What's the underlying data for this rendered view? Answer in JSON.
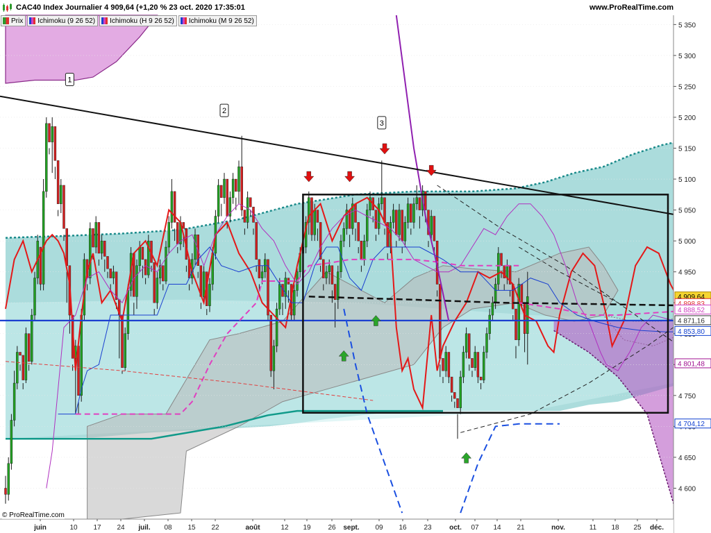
{
  "header": {
    "title": "CAC40 Index Journalier 4 909,64 (+1,20 % 23 oct. 2020 17:35:01",
    "site": "www.ProRealTime.com"
  },
  "legend": [
    {
      "label": "Prix",
      "color": "#2e9a2e"
    },
    {
      "label": "Ichimoku (9 26 52)",
      "color": "#9b3fc9"
    },
    {
      "label": "Ichimoku (H 9 26 52)",
      "color": "#9b3fc9"
    },
    {
      "label": "Ichimoku (M 9 26 52)",
      "color": "#9b3fc9"
    }
  ],
  "copyright": "© ProRealTime.com",
  "chart_data": {
    "type": "candlestick",
    "y_range": [
      4550,
      5365
    ],
    "y_ticks": [
      {
        "v": 5350,
        "label": "5 350"
      },
      {
        "v": 5300,
        "label": "5 300"
      },
      {
        "v": 5250,
        "label": "5 250"
      },
      {
        "v": 5200,
        "label": "5 200"
      },
      {
        "v": 5150,
        "label": "5 150"
      },
      {
        "v": 5100,
        "label": "5 100"
      },
      {
        "v": 5050,
        "label": "5 050"
      },
      {
        "v": 5000,
        "label": "5 000"
      },
      {
        "v": 4950,
        "label": "4 950"
      },
      {
        "v": 4900,
        "label": "4 900"
      },
      {
        "v": 4850,
        "label": "4 850"
      },
      {
        "v": 4800,
        "label": "4 800"
      },
      {
        "v": 4750,
        "label": "4 750"
      },
      {
        "v": 4700,
        "label": "4 700"
      },
      {
        "v": 4650,
        "label": "4 650"
      },
      {
        "v": 4600,
        "label": "4 600"
      }
    ],
    "x_ticks": [
      {
        "label": "juin",
        "bold": true
      },
      {
        "label": "10"
      },
      {
        "label": "17"
      },
      {
        "label": "24"
      },
      {
        "label": "juil.",
        "bold": true
      },
      {
        "label": "08"
      },
      {
        "label": "15"
      },
      {
        "label": "22"
      },
      {
        "label": "août",
        "bold": true
      },
      {
        "label": "12"
      },
      {
        "label": "19"
      },
      {
        "label": "26"
      },
      {
        "label": "sept.",
        "bold": true
      },
      {
        "label": "09"
      },
      {
        "label": "16"
      },
      {
        "label": "23"
      },
      {
        "label": "oct.",
        "bold": true
      },
      {
        "label": "07"
      },
      {
        "label": "14"
      },
      {
        "label": "21"
      },
      {
        "label": "nov.",
        "bold": true
      },
      {
        "label": "11"
      },
      {
        "label": "18"
      },
      {
        "label": "25"
      },
      {
        "label": "déc.",
        "bold": true
      }
    ],
    "price_badges": [
      {
        "v": 4909.64,
        "label": "4 909,64",
        "bg": "#f5d530",
        "fg": "#000000"
      },
      {
        "v": 4898.83,
        "label": "4 898,83",
        "bg": "#ffffff",
        "fg": "#e03030"
      },
      {
        "v": 4888.52,
        "label": "4 888,52",
        "bg": "#ffffff",
        "fg": "#d040c0"
      },
      {
        "v": 4871.16,
        "label": "4 871,16",
        "bg": "#ffffff",
        "fg": "#303030"
      },
      {
        "v": 4853.8,
        "label": "4 853,80",
        "bg": "#ffffff",
        "fg": "#1040d0"
      },
      {
        "v": 4801.48,
        "label": "4 801,48",
        "bg": "#ffffff",
        "fg": "#a01090"
      },
      {
        "v": 4704.12,
        "label": "4 704,12",
        "bg": "#ffffff",
        "fg": "#1040d0"
      }
    ],
    "annotations": [
      {
        "label": "1",
        "index": 22,
        "v": 5260
      },
      {
        "label": "2",
        "index": 75,
        "v": 5210
      },
      {
        "label": "3",
        "index": 129,
        "v": 5190
      }
    ],
    "candles": [
      [
        4600,
        4620,
        4575,
        4590
      ],
      [
        4590,
        4650,
        4580,
        4640
      ],
      [
        4640,
        4720,
        4630,
        4710
      ],
      [
        4710,
        4790,
        4700,
        4770
      ],
      [
        4770,
        4830,
        4760,
        4820
      ],
      [
        4820,
        4800,
        4790,
        4815
      ],
      [
        4815,
        4770,
        4760,
        4775
      ],
      [
        4775,
        4860,
        4770,
        4850
      ],
      [
        4850,
        4800,
        4790,
        4805
      ],
      [
        4805,
        4890,
        4800,
        4880
      ],
      [
        4880,
        4950,
        4870,
        4940
      ],
      [
        4940,
        5010,
        4930,
        5000
      ],
      [
        4990,
        4930,
        4920,
        4930
      ],
      [
        4930,
        5100,
        4920,
        5080
      ],
      [
        5080,
        5200,
        5070,
        5190
      ],
      [
        5190,
        5150,
        5140,
        5160
      ],
      [
        5160,
        5200,
        5110,
        5185
      ],
      [
        5185,
        5120,
        5100,
        5130
      ],
      [
        5130,
        5050,
        5040,
        5060
      ],
      [
        5060,
        5100,
        5045,
        5090
      ],
      [
        5090,
        5010,
        5000,
        5020
      ],
      [
        5020,
        4950,
        4900,
        4960
      ],
      [
        4960,
        4890,
        4850,
        4880
      ],
      [
        4880,
        4800,
        4790,
        4810
      ],
      [
        4810,
        4840,
        4720,
        4830
      ],
      [
        4830,
        4740,
        4720,
        4750
      ],
      [
        4750,
        4890,
        4740,
        4880
      ],
      [
        4880,
        4980,
        4870,
        4970
      ],
      [
        4970,
        4930,
        4920,
        4940
      ],
      [
        4940,
        5030,
        4930,
        5020
      ],
      [
        5020,
        4980,
        4970,
        4990
      ],
      [
        4990,
        5040,
        4980,
        5030
      ],
      [
        5030,
        4970,
        4960,
        4980
      ],
      [
        4980,
        5010,
        4970,
        5000
      ],
      [
        5000,
        4970,
        4950,
        4975
      ],
      [
        4975,
        4950,
        4940,
        4955
      ],
      [
        4955,
        4930,
        4920,
        4940
      ],
      [
        4940,
        4960,
        4930,
        4950
      ],
      [
        4950,
        4900,
        4890,
        4905
      ],
      [
        4905,
        4880,
        4810,
        4880
      ],
      [
        4880,
        4790,
        4785,
        4795
      ],
      [
        4795,
        4860,
        4790,
        4850
      ],
      [
        4850,
        4930,
        4840,
        4920
      ],
      [
        4920,
        4990,
        4910,
        4980
      ],
      [
        4980,
        4900,
        4880,
        4910
      ],
      [
        4910,
        4970,
        4890,
        4960
      ],
      [
        4960,
        5000,
        4950,
        4990
      ],
      [
        4990,
        4960,
        4940,
        4970
      ],
      [
        4970,
        4940,
        4930,
        4945
      ],
      [
        4945,
        5010,
        4940,
        5000
      ],
      [
        5000,
        4960,
        4950,
        4965
      ],
      [
        4965,
        4890,
        4880,
        4900
      ],
      [
        4900,
        4950,
        4890,
        4940
      ],
      [
        4940,
        4970,
        4930,
        4960
      ],
      [
        4960,
        4930,
        4920,
        4935
      ],
      [
        4935,
        5000,
        4930,
        4990
      ],
      [
        4990,
        5040,
        4980,
        5030
      ],
      [
        5030,
        5100,
        5020,
        5080
      ],
      [
        5080,
        5020,
        5000,
        5030
      ],
      [
        5030,
        4990,
        4980,
        4995
      ],
      [
        4995,
        5040,
        4985,
        5030
      ],
      [
        5030,
        5010,
        4990,
        5020
      ],
      [
        5020,
        4960,
        4950,
        4970
      ],
      [
        4970,
        4930,
        4920,
        4940
      ],
      [
        4940,
        4980,
        4930,
        4970
      ],
      [
        4970,
        5020,
        4960,
        5010
      ],
      [
        5010,
        4950,
        4940,
        4960
      ],
      [
        4960,
        4900,
        4890,
        4910
      ],
      [
        4910,
        4960,
        4900,
        4950
      ],
      [
        4950,
        4890,
        4880,
        4895
      ],
      [
        4895,
        4940,
        4885,
        4930
      ],
      [
        4930,
        4990,
        4920,
        4980
      ],
      [
        4980,
        5050,
        4970,
        5040
      ],
      [
        5040,
        5100,
        5030,
        5090
      ],
      [
        5090,
        5060,
        5040,
        5070
      ],
      [
        5070,
        5110,
        5060,
        5100
      ],
      [
        5100,
        5030,
        5020,
        5040
      ],
      [
        5040,
        5080,
        5030,
        5070
      ],
      [
        5070,
        5110,
        5060,
        5100
      ],
      [
        5100,
        5070,
        5050,
        5080
      ],
      [
        5080,
        5130,
        5060,
        5120
      ],
      [
        5120,
        5170,
        5040,
        5050
      ],
      [
        5050,
        5020,
        5010,
        5030
      ],
      [
        5030,
        5080,
        5020,
        5070
      ],
      [
        5070,
        5050,
        5040,
        5055
      ],
      [
        5055,
        5020,
        5010,
        5030
      ],
      [
        5030,
        4960,
        4950,
        4970
      ],
      [
        4970,
        4930,
        4920,
        4940
      ],
      [
        4940,
        4960,
        4930,
        4950
      ],
      [
        4950,
        4980,
        4940,
        4970
      ],
      [
        4970,
        4900,
        4870,
        4880
      ],
      [
        4880,
        4800,
        4780,
        4790
      ],
      [
        4790,
        4840,
        4760,
        4830
      ],
      [
        4830,
        4900,
        4820,
        4890
      ],
      [
        4890,
        4940,
        4880,
        4930
      ],
      [
        4930,
        4900,
        4880,
        4910
      ],
      [
        4910,
        4950,
        4890,
        4940
      ],
      [
        4940,
        4920,
        4900,
        4930
      ],
      [
        4930,
        4890,
        4870,
        4880
      ],
      [
        4880,
        4930,
        4870,
        4920
      ],
      [
        4920,
        4960,
        4910,
        4950
      ],
      [
        4950,
        4990,
        4940,
        4980
      ],
      [
        4980,
        5000,
        4950,
        4990
      ],
      [
        4990,
        5040,
        4980,
        5030
      ],
      [
        5030,
        5080,
        5010,
        5070
      ],
      [
        5070,
        5060,
        5000,
        5010
      ],
      [
        5010,
        5060,
        5000,
        5050
      ],
      [
        5050,
        5020,
        5000,
        5030
      ],
      [
        5030,
        4960,
        4950,
        4970
      ],
      [
        4970,
        4930,
        4920,
        4940
      ],
      [
        4940,
        4960,
        4930,
        4950
      ],
      [
        4950,
        4970,
        4930,
        4960
      ],
      [
        4960,
        4920,
        4900,
        4930
      ],
      [
        4930,
        4900,
        4860,
        4905
      ],
      [
        4905,
        4960,
        4890,
        4950
      ],
      [
        4950,
        5010,
        4940,
        5000
      ],
      [
        5000,
        5030,
        4990,
        5020
      ],
      [
        5020,
        5060,
        5010,
        5050
      ],
      [
        5050,
        5010,
        4990,
        5020
      ],
      [
        5020,
        5070,
        5010,
        5060
      ],
      [
        5060,
        5020,
        5000,
        5030
      ],
      [
        5030,
        4990,
        4980,
        5000
      ],
      [
        5000,
        4960,
        4950,
        4970
      ],
      [
        4970,
        5010,
        4960,
        5000
      ],
      [
        5000,
        5060,
        4990,
        5050
      ],
      [
        5050,
        5080,
        5040,
        5070
      ],
      [
        5070,
        5040,
        5030,
        5050
      ],
      [
        5050,
        5010,
        5000,
        5020
      ],
      [
        5020,
        5070,
        5010,
        5060
      ],
      [
        5060,
        5130,
        5050,
        5070
      ],
      [
        5070,
        5020,
        5010,
        5030
      ],
      [
        5030,
        4980,
        4970,
        4990
      ],
      [
        4990,
        5040,
        4980,
        5030
      ],
      [
        5030,
        5060,
        5020,
        5050
      ],
      [
        5050,
        5000,
        4990,
        5010
      ],
      [
        5010,
        5060,
        5000,
        5050
      ],
      [
        5050,
        4990,
        4980,
        5000
      ],
      [
        5000,
        5040,
        4990,
        5030
      ],
      [
        5030,
        5070,
        5020,
        5060
      ],
      [
        5060,
        5020,
        5010,
        5030
      ],
      [
        5030,
        5070,
        5020,
        5060
      ],
      [
        5060,
        5090,
        5050,
        5070
      ],
      [
        5070,
        5040,
        5020,
        5050
      ],
      [
        5050,
        5090,
        5040,
        5080
      ],
      [
        5080,
        5040,
        5030,
        5050
      ],
      [
        5050,
        5000,
        4990,
        5010
      ],
      [
        5010,
        5050,
        5000,
        5040
      ],
      [
        5040,
        4990,
        4980,
        5000
      ],
      [
        5000,
        4920,
        4910,
        4930
      ],
      [
        4930,
        4800,
        4780,
        4810
      ],
      [
        4810,
        4780,
        4770,
        4790
      ],
      [
        4790,
        4830,
        4780,
        4820
      ],
      [
        4820,
        4790,
        4770,
        4780
      ],
      [
        4780,
        4750,
        4740,
        4755
      ],
      [
        4755,
        4740,
        4730,
        4745
      ],
      [
        4745,
        4720,
        4680,
        4730
      ],
      [
        4730,
        4790,
        4720,
        4780
      ],
      [
        4780,
        4830,
        4770,
        4820
      ],
      [
        4820,
        4860,
        4810,
        4850
      ],
      [
        4850,
        4800,
        4790,
        4810
      ],
      [
        4810,
        4790,
        4780,
        4795
      ],
      [
        4795,
        4830,
        4790,
        4820
      ],
      [
        4820,
        4790,
        4770,
        4780
      ],
      [
        4780,
        4770,
        4760,
        4775
      ],
      [
        4775,
        4830,
        4770,
        4820
      ],
      [
        4820,
        4860,
        4810,
        4850
      ],
      [
        4850,
        4890,
        4840,
        4880
      ],
      [
        4880,
        4910,
        4870,
        4900
      ],
      [
        4900,
        4940,
        4890,
        4930
      ],
      [
        4930,
        4990,
        4920,
        4980
      ],
      [
        4980,
        4950,
        4940,
        4960
      ],
      [
        4960,
        4930,
        4920,
        4940
      ],
      [
        4940,
        4970,
        4930,
        4960
      ],
      [
        4960,
        4920,
        4910,
        4930
      ],
      [
        4930,
        4880,
        4870,
        4890
      ],
      [
        4890,
        4830,
        4810,
        4840
      ],
      [
        4840,
        4940,
        4830,
        4930
      ],
      [
        4930,
        4910,
        4890,
        4900
      ],
      [
        4900,
        4860,
        4820,
        4850
      ],
      [
        4850,
        4950,
        4800,
        4910
      ]
    ]
  }
}
